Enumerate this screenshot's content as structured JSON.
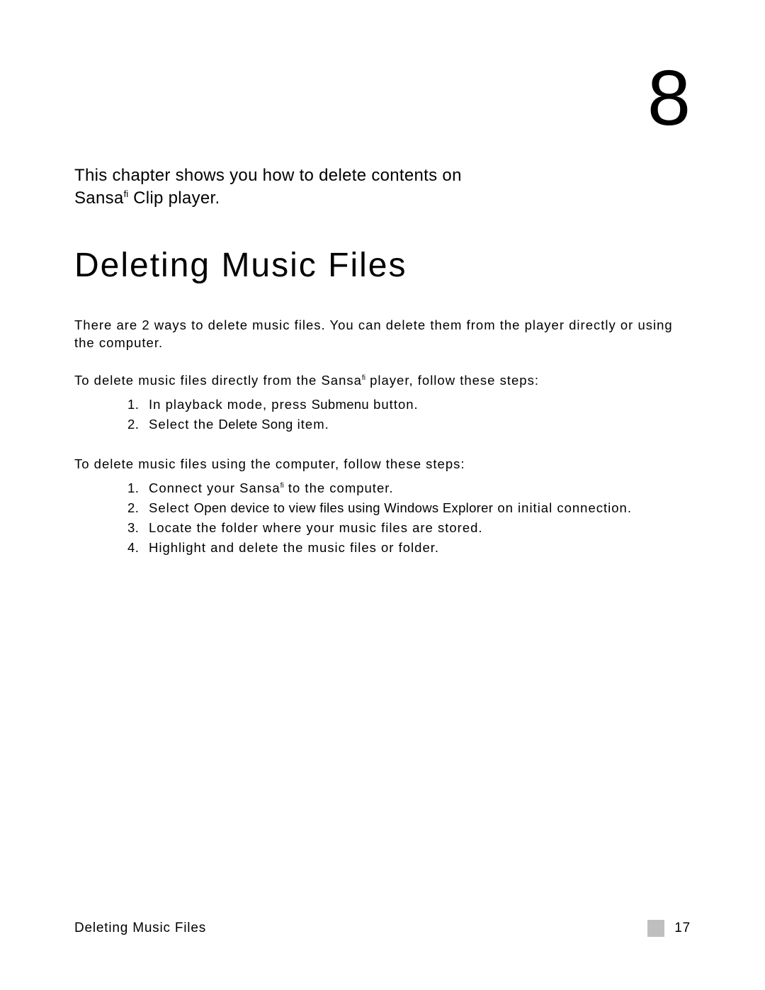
{
  "chapter": {
    "number": "8",
    "intro_line1": "This chapter shows you how to delete contents on",
    "intro_line2a": "Sansa",
    "intro_tm": "fi",
    "intro_line2b": " Clip player.",
    "title": "Deleting Music Files"
  },
  "body": {
    "p1": "There are 2 ways to delete music files. You can delete them from the player directly or using the computer.",
    "p2a": "To delete music files directly from the Sansa",
    "p2_tm": "fi",
    "p2b": " player, follow these steps:",
    "steps_direct": [
      {
        "num": "1.",
        "parts": [
          {
            "text": "In playback mode, press ",
            "emph": false
          },
          {
            "text": "Submenu",
            "emph": true
          },
          {
            "text": " button.",
            "emph": false
          }
        ]
      },
      {
        "num": "2.",
        "parts": [
          {
            "text": "Select the ",
            "emph": false
          },
          {
            "text": "Delete Song",
            "emph": true
          },
          {
            "text": " item.",
            "emph": false
          }
        ]
      }
    ],
    "p3": "To delete music files using the computer, follow these steps:",
    "steps_computer": [
      {
        "num": "1.",
        "parts": [
          {
            "text": "Connect your Sansa",
            "emph": false
          },
          {
            "text": "fi",
            "emph": false,
            "sup": true
          },
          {
            "text": " to the computer.",
            "emph": false
          }
        ]
      },
      {
        "num": "2.",
        "parts": [
          {
            "text": "Select ",
            "emph": false
          },
          {
            "text": "Open device to view files using Windows Explorer",
            "emph": true
          },
          {
            "text": " on initial connection.",
            "emph": false
          }
        ]
      },
      {
        "num": "3.",
        "parts": [
          {
            "text": "Locate the folder where your music files are stored.",
            "emph": false
          }
        ]
      },
      {
        "num": "4.",
        "parts": [
          {
            "text": "Highlight and delete the music files or folder.",
            "emph": false
          }
        ]
      }
    ]
  },
  "footer": {
    "left": "Deleting Music Files",
    "page_number": "17"
  }
}
